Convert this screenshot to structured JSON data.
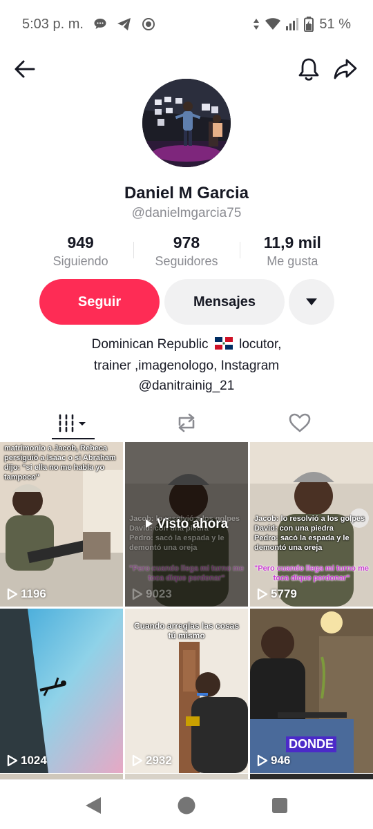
{
  "status_bar": {
    "time": "5:03 p. m.",
    "battery": "51 %",
    "icons": [
      "message-bubble-icon",
      "telegram-icon",
      "record-icon",
      "data-arrows-icon",
      "wifi-icon",
      "signal-icon",
      "battery-charging-icon"
    ]
  },
  "nav": {
    "back_icon": "back-arrow-icon",
    "bell_icon": "bell-icon",
    "share_icon": "share-icon"
  },
  "profile": {
    "name": "Daniel M Garcia",
    "handle": "@danielmgarcia75"
  },
  "stats": [
    {
      "value": "949",
      "label": "Siguiendo"
    },
    {
      "value": "978",
      "label": "Seguidores"
    },
    {
      "value": "11,9 mil",
      "label": "Me gusta"
    }
  ],
  "actions": {
    "follow": "Seguir",
    "messages": "Mensajes",
    "more_icon": "caret-down-icon"
  },
  "bio": {
    "line1_pre": "Dominican Republic",
    "line1_post": "locutor,",
    "line2": "trainer ,imagenologo, Instagram",
    "line3": "@danitrainig_21"
  },
  "tabs": [
    {
      "name": "videos",
      "icon": "grid-icon",
      "active": true
    },
    {
      "name": "reposts",
      "icon": "repost-icon",
      "active": false
    },
    {
      "name": "liked",
      "icon": "heart-icon",
      "active": false
    }
  ],
  "videos": [
    {
      "views": "1196",
      "caption": "matrimonio a Jacob, Rebeca persiguió a Isaac o si Abraham dijo:  \"si ella no me habla yo tampoco\""
    },
    {
      "views": "9023",
      "seen": "Visto ahora",
      "caption_top": "Jacob: lo resolvió a los golpes\nDavid: con una piedra\nPedro: sacó la espada y le demontó una oreja",
      "caption_pink": "\"Pero cuando llega mi turno me toca dique perdonar\""
    },
    {
      "views": "5779",
      "caption_top": "Jacob: lo resolvió a los golpes\nDavid: con una piedra\nPedro: sacó la espada y le demontó una oreja",
      "caption_pink": "\"Pero cuando llega mi turno me toca dique perdonar\""
    },
    {
      "views": "1024"
    },
    {
      "views": "2932",
      "caption": "Cuando arreglas las cosas tú mismo"
    },
    {
      "views": "946",
      "sticker": "DONDE"
    }
  ],
  "system_nav": {
    "back_icon": "triangle-back-icon",
    "home_icon": "circle-home-icon",
    "recents_icon": "square-recents-icon"
  },
  "colors": {
    "follow_button": "#fe2c55",
    "secondary_button": "#f1f1f2",
    "text_primary": "#161823",
    "text_secondary": "#8a8b91"
  }
}
